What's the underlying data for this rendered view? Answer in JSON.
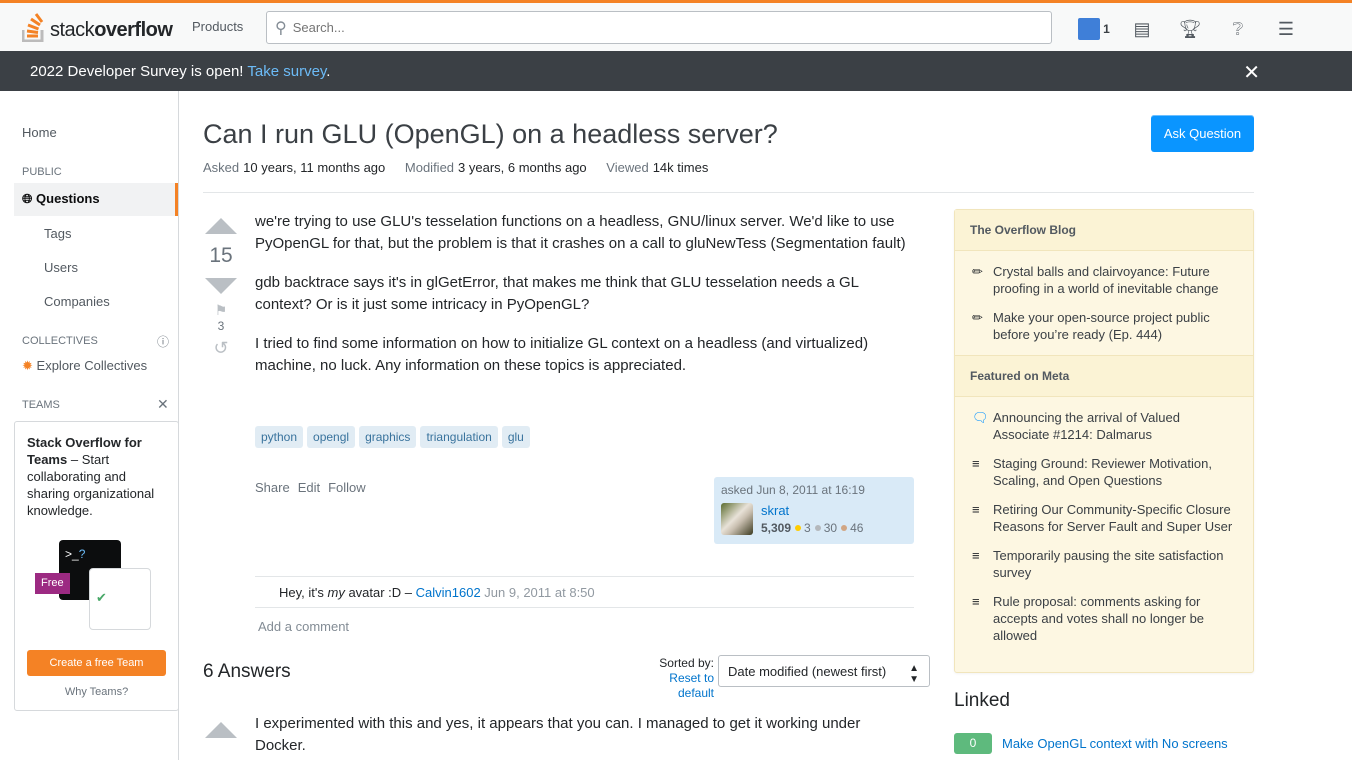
{
  "header": {
    "logo_a": "stack",
    "logo_b": "overflow",
    "products": "Products",
    "search_placeholder": "Search...",
    "rep": "1"
  },
  "banner": {
    "text": "2022 Developer Survey is open! ",
    "link": "Take survey",
    "end": ".",
    "close": "✕"
  },
  "sidebar": {
    "home": "Home",
    "public": "PUBLIC",
    "questions": "Questions",
    "tags": "Tags",
    "users": "Users",
    "companies": "Companies",
    "collectives": "COLLECTIVES",
    "explore": "Explore Collectives",
    "teams": "TEAMS",
    "teams_title": "Stack Overflow for Teams",
    "teams_text": " – Start collaborating and sharing organizational knowledge.",
    "free": "Free",
    "create_team": "Create a free Team",
    "why": "Why Teams?"
  },
  "question": {
    "title": "Can I run GLU (OpenGL) on a headless server?",
    "asked_label": "Asked",
    "asked": "10 years, 11 months ago",
    "modified_label": "Modified",
    "modified": "3 years, 6 months ago",
    "viewed_label": "Viewed",
    "viewed": "14k times",
    "ask_button": "Ask Question",
    "score": "15",
    "bookmarks": "3",
    "body": [
      "we're trying to use GLU's tesselation functions on a headless, GNU/linux server. We'd like to use PyOpenGL for that, but the problem is that it crashes on a call to gluNewTess (Segmentation fault)",
      "gdb backtrace says it's in glGetError, that makes me think that GLU tesselation needs a GL context? Or is it just some intricacy in PyOpenGL?",
      "I tried to find some information on how to initialize GL context on a headless (and virtualized) machine, no luck. Any information on these topics is appreciated."
    ],
    "tags": [
      "python",
      "opengl",
      "graphics",
      "triangulation",
      "glu"
    ],
    "menu": [
      "Share",
      "Edit",
      "Follow"
    ],
    "asked_card": "asked Jun 8, 2011 at 16:19",
    "user": "skrat",
    "user_rep": "5,309",
    "gold": "3",
    "silver": "30",
    "bronze": "46",
    "comment": {
      "pre": "Hey, it's ",
      "em": "my",
      "post": " avatar :D – ",
      "user": "Calvin1602",
      "date": " Jun 9, 2011 at 8:50"
    },
    "add_comment": "Add a comment"
  },
  "answers": {
    "count": "6 Answers",
    "sorted_by": "Sorted by:",
    "reset": "Reset to default",
    "sort_value": "Date modified (newest first)",
    "first_answer": "I experimented with this and yes, it appears that you can. I managed to get it working under Docker."
  },
  "blog": {
    "title": "The Overflow Blog",
    "items": [
      "Crystal balls and clairvoyance: Future proofing in a world of inevitable change",
      "Make your open-source project public before you’re ready (Ep. 444)"
    ],
    "meta_title": "Featured on Meta",
    "meta_items": [
      "Announcing the arrival of Valued Associate #1214: Dalmarus",
      "Staging Ground: Reviewer Motivation, Scaling, and Open Questions",
      "Retiring Our Community-Specific Closure Reasons for Server Fault and Super User",
      "Temporarily pausing the site satisfaction survey",
      "Rule proposal: comments asking for accepts and votes shall no longer be allowed"
    ]
  },
  "linked": {
    "title": "Linked",
    "items": [
      {
        "score": "0",
        "title": "Make OpenGL context with No screens"
      }
    ]
  }
}
